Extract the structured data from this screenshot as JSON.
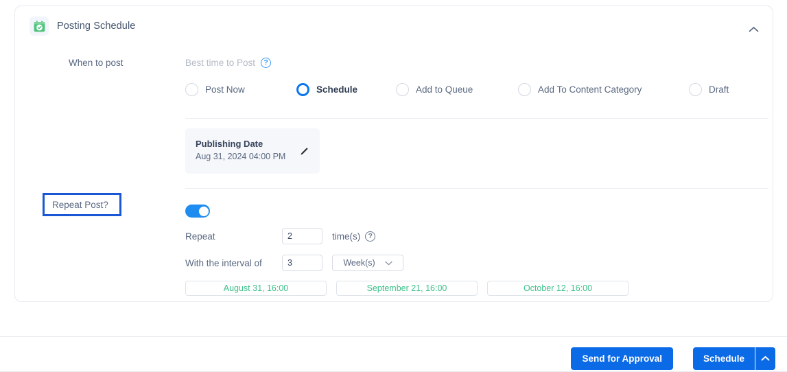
{
  "card": {
    "icon_name": "calendar-check-icon",
    "title": "Posting Schedule",
    "collapse_icon": "chevron-up-icon"
  },
  "left_labels": {
    "when_to_post": "When to post",
    "repeat_post": "Repeat Post?"
  },
  "best_time": {
    "text": "Best time to Post",
    "help_icon": "help-circle-icon"
  },
  "radios": [
    {
      "label": "Post Now",
      "selected": false
    },
    {
      "label": "Schedule",
      "selected": true
    },
    {
      "label": "Add to Queue",
      "selected": false
    },
    {
      "label": "Add To Content Category",
      "selected": false
    },
    {
      "label": "Draft",
      "selected": false
    }
  ],
  "publishing_date": {
    "title": "Publishing Date",
    "value": "Aug 31, 2024 04:00 PM",
    "edit_icon": "pencil-icon"
  },
  "repeat": {
    "toggle_on": true,
    "repeat_label": "Repeat",
    "repeat_count": "2",
    "times_suffix": "time(s)",
    "times_help_icon": "help-circle-icon",
    "interval_label": "With the interval of",
    "interval_value": "3",
    "interval_unit": "Week(s)",
    "interval_unit_caret": "chevron-down-icon"
  },
  "occurrences": [
    "August 31, 16:00",
    "September 21, 16:00",
    "October 12, 16:00"
  ],
  "footer": {
    "send_for_approval": "Send for Approval",
    "schedule": "Schedule",
    "schedule_caret_icon": "chevron-up-icon"
  },
  "colors": {
    "accent_blue": "#0b6ae6",
    "toggle_blue": "#1f8cf0",
    "highlight_blue": "#1a57d6",
    "green": "#3ec08a",
    "icon_green": "#53c37f"
  }
}
